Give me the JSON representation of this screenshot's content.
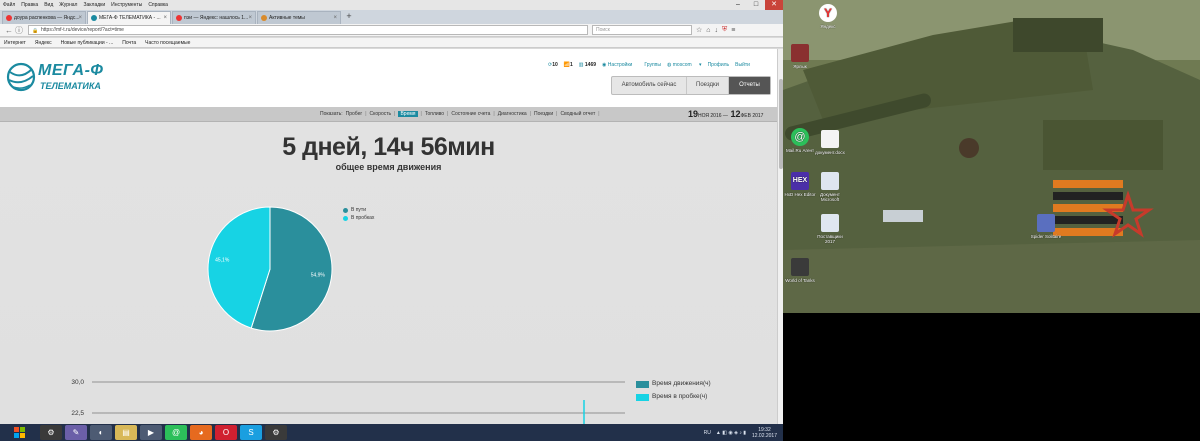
{
  "browser": {
    "menu": [
      "Файл",
      "Правка",
      "Вид",
      "Журнал",
      "Закладки",
      "Инструменты",
      "Справка"
    ],
    "tabs": [
      {
        "label": "доура распенкова — Яндс...",
        "active": false
      },
      {
        "label": "МЕГА-Ф ТЕЛЕМАТИКА - ...",
        "active": true
      },
      {
        "label": "пэи — Яндекс: нашлось 1...",
        "active": false
      },
      {
        "label": "Активные темы",
        "active": false
      }
    ],
    "url": "https://mf-t.ru/device/report/?act=time",
    "search_placeholder": "Поиск",
    "bookmarks": [
      "Интернет",
      "Яндекс",
      "Новые публикации - ...",
      "Почта",
      "Часто посещаемые"
    ]
  },
  "site": {
    "logo_line1": "МЕГА-Ф",
    "logo_line2": "ТЕЛЕМАТИКА",
    "top_info": {
      "online": "10",
      "signal": "1",
      "balance": "1469",
      "settings": "Настройки",
      "groups": "Группы",
      "user": "moscom",
      "profile": "Профиль",
      "logout": "Выйти"
    },
    "nav": {
      "now": "Автомобиль сейчас",
      "trips": "Поездки",
      "reports": "Отчеты"
    },
    "subnav": {
      "show_label": "Показать:",
      "links": [
        "Пробег",
        "Скорость",
        "Время",
        "Топливо",
        "Состояние счета",
        "Диагностика",
        "Поездки",
        "Сводный отчет"
      ],
      "active_index": 2
    },
    "date_from_day": "19",
    "date_from_rest": "НОЯ 2016 —",
    "date_to_day": "12",
    "date_to_rest": "ФЕВ 2017"
  },
  "report": {
    "total": "5 дней, 14ч 56мин",
    "subtitle": "общее время движения"
  },
  "chart_data": [
    {
      "type": "pie",
      "legend_placement": "top",
      "slices": [
        {
          "name": "В пути",
          "value": 54.9,
          "label": "54,9%",
          "color": "#2a8f9c"
        },
        {
          "name": "В пробках",
          "value": 45.1,
          "label": "45,1%",
          "color": "#17d3e4"
        }
      ]
    },
    {
      "type": "bar",
      "y_ticks": [
        "30,0",
        "22,5"
      ],
      "ylim": [
        0,
        30
      ],
      "grid": true,
      "legend_placement": "right",
      "series": [
        {
          "name": "Время движения(ч)",
          "color": "#2a8f9c"
        },
        {
          "name": "Время в пробке(ч)",
          "color": "#17d3e4"
        }
      ]
    }
  ],
  "desktop": {
    "icons": [
      "Яндекс",
      "Ярлык",
      "Mail.Ru Агент",
      "документ.docx",
      "HxD Hex Editor",
      "Документ Microsoft",
      "Поставщики 2017",
      "World of Tanks",
      "Spider Solitaire"
    ]
  },
  "taskbar": {
    "lang": "RU",
    "time": "19:32",
    "date": "12.02.2017"
  },
  "colors": {
    "brand": "#1b8aa0",
    "dark_slice": "#2a8f9c",
    "light_slice": "#17d3e4"
  }
}
